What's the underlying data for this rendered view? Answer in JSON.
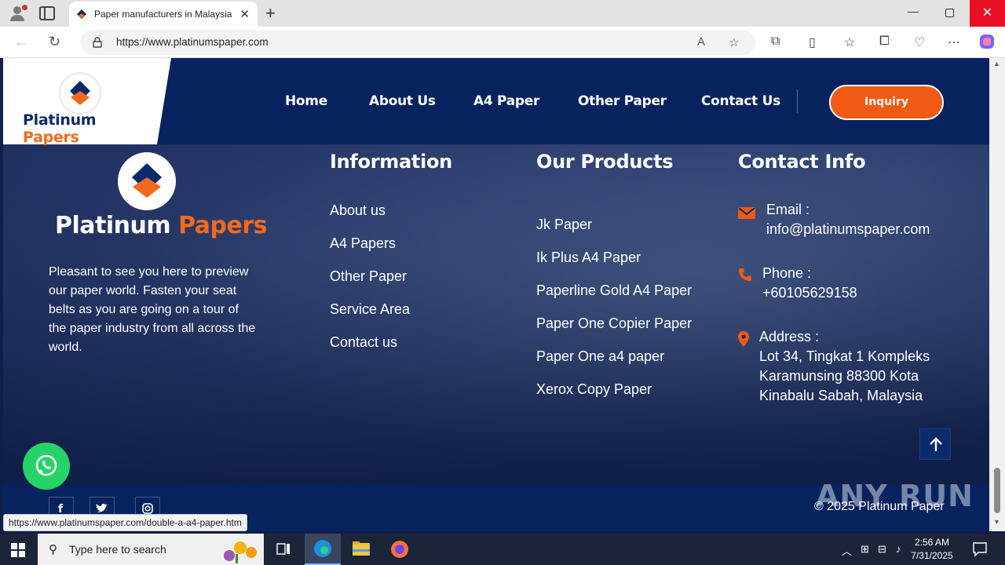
{
  "browser": {
    "tab_title": "Paper manufacturers in Malaysia,",
    "tab_close": "✕",
    "new_tab": "+",
    "url": "https://www.platinumspaper.com",
    "window_min": "—",
    "window_close": "✕"
  },
  "header": {
    "logo_part1": "Platinum",
    "logo_part2": "Papers",
    "menu": [
      "Home",
      "About Us",
      "A4 Paper",
      "Other Paper",
      "Contact Us"
    ],
    "inquiry_label": "Inquiry"
  },
  "footer": {
    "logo_part1": "Platinum",
    "logo_part2": "Papers",
    "about_text": "Pleasant to see you here to preview our paper world. Fasten your seat belts as you are going on a tour of the paper industry from all across the world.",
    "information": {
      "title": "Information",
      "links": [
        "About us",
        "A4 Papers",
        "Other Paper",
        "Service Area",
        "Contact us"
      ]
    },
    "products": {
      "title": "Our Products",
      "links": [
        "Jk Paper",
        "Ik Plus A4 Paper",
        "Paperline Gold A4 Paper",
        "Paper One Copier Paper",
        "Paper One a4 paper",
        "Xerox Copy Paper"
      ]
    },
    "contact": {
      "title": "Contact Info",
      "email_label": "Email :",
      "email_value": "info@platinumspaper.com",
      "phone_label": "Phone :",
      "phone_value": "+60105629158",
      "address_label": "Address :",
      "address_line1": "Lot 34, Tingkat 1 Kompleks",
      "address_line2": "Karamunsing 88300 Kota",
      "address_line3": "Kinabalu Sabah, Malaysia"
    },
    "copyright": "© 2025 Platinum Paper",
    "watermark": "ANY RUN"
  },
  "status_bar_url": "https://www.platinumspaper.com/double-a-a4-paper.htm",
  "taskbar": {
    "search_placeholder": "Type here to search",
    "time": "2:56 AM",
    "date": "7/31/2025"
  },
  "colors": {
    "accent_orange": "#f15a14",
    "navy": "#07235f",
    "whatsapp_green": "#25d366"
  }
}
